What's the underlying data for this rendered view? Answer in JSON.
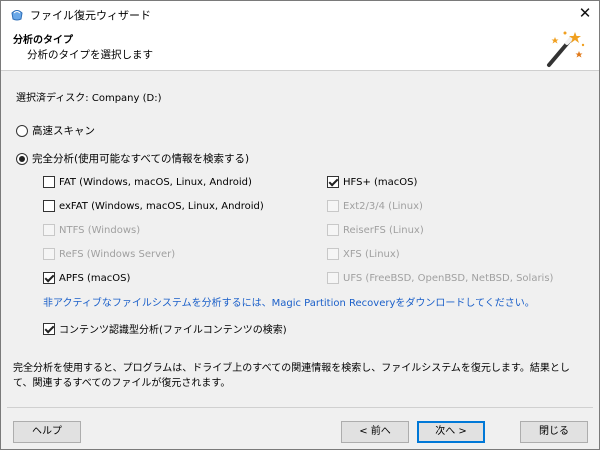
{
  "window": {
    "title": "ファイル復元ウィザード",
    "close_glyph": "✕"
  },
  "header": {
    "title": "分析のタイプ",
    "subtitle": "分析のタイプを選択します",
    "icon": "magic-wand-icon"
  },
  "disk": {
    "label": "選択済ディスク: Company (D:)"
  },
  "options": {
    "quick_scan": {
      "label": "高速スキャン",
      "selected": false
    },
    "full_analysis": {
      "label": "完全分析(使用可能なすべての情報を検索する)",
      "selected": true
    }
  },
  "filesystems": {
    "left": [
      {
        "label": "FAT (Windows, macOS, Linux, Android)",
        "checked": false,
        "enabled": true
      },
      {
        "label": "exFAT (Windows, macOS, Linux, Android)",
        "checked": false,
        "enabled": true
      },
      {
        "label": "NTFS (Windows)",
        "checked": false,
        "enabled": false
      },
      {
        "label": "ReFS (Windows Server)",
        "checked": false,
        "enabled": false
      },
      {
        "label": "APFS (macOS)",
        "checked": true,
        "enabled": true
      }
    ],
    "right": [
      {
        "label": "HFS+ (macOS)",
        "checked": true,
        "enabled": true
      },
      {
        "label": "Ext2/3/4 (Linux)",
        "checked": false,
        "enabled": false
      },
      {
        "label": "ReiserFS (Linux)",
        "checked": false,
        "enabled": false
      },
      {
        "label": "XFS (Linux)",
        "checked": false,
        "enabled": false
      },
      {
        "label": "UFS (FreeBSD, OpenBSD, NetBSD, Solaris)",
        "checked": false,
        "enabled": false
      }
    ]
  },
  "note_link": "非アクティブなファイルシステムを分析するには、Magic Partition Recoveryをダウンロードしてください。",
  "content_analysis": {
    "label": "コンテンツ認識型分析(ファイルコンテンツの検索)",
    "checked": true
  },
  "info_text": "完全分析を使用すると、プログラムは、ドライブ上のすべての関連情報を検索し、ファイルシステムを復元します。結果として、関連するすべてのファイルが復元されます。",
  "buttons": {
    "help": "ヘルプ",
    "back": "< 前へ",
    "next": "次へ >",
    "close": "閉じる"
  },
  "colors": {
    "link": "#1a5fc9",
    "accent": "#0078d7",
    "disabled_text": "#a0a0a0"
  }
}
